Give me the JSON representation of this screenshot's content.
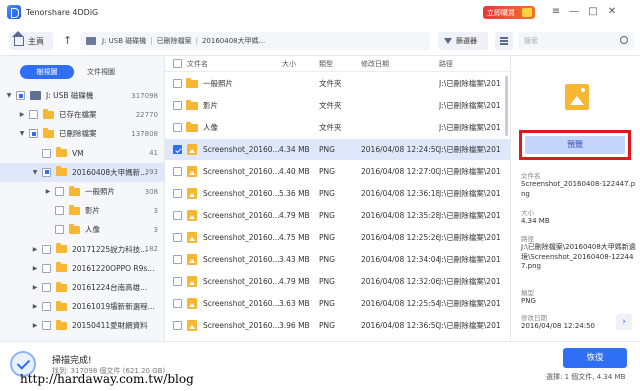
{
  "app": {
    "title": "Tenorshare 4DDiG",
    "buy_label": "立即購買"
  },
  "window_controls": [
    "—",
    "□",
    "✕"
  ],
  "toolbar": {
    "home_label": "主頁",
    "path": [
      "J: USB 磁碟機",
      "已刪除檔案",
      "20160408大甲媽..."
    ],
    "filter_label": "篩選器",
    "search_placeholder": "搜索"
  },
  "left": {
    "tabs": [
      "樹視圖",
      "文件視圖"
    ],
    "tree": [
      {
        "label": "J: USB 磁碟機",
        "count": "317098",
        "level": 0,
        "expand": "▼",
        "check": "part",
        "icon": "drive",
        "selected": false
      },
      {
        "label": "已存在檔案",
        "count": "22770",
        "level": 1,
        "expand": "▶",
        "check": "none",
        "icon": "folder",
        "selected": false
      },
      {
        "label": "已刪除檔案",
        "count": "137808",
        "level": 1,
        "expand": "▼",
        "check": "part",
        "icon": "folder",
        "selected": false
      },
      {
        "label": "VM",
        "count": "41",
        "level": 2,
        "expand": "",
        "check": "none",
        "icon": "folder",
        "selected": false
      },
      {
        "label": "20160408大甲媽新...",
        "count": "393",
        "level": 2,
        "expand": "▼",
        "check": "part",
        "icon": "folder",
        "selected": true
      },
      {
        "label": "一般照片",
        "count": "308",
        "level": 3,
        "expand": "▶",
        "check": "none",
        "icon": "folder",
        "selected": false
      },
      {
        "label": "影片",
        "count": "3",
        "level": 3,
        "expand": "",
        "check": "none",
        "icon": "folder",
        "selected": false
      },
      {
        "label": "人像",
        "count": "3",
        "level": 3,
        "expand": "",
        "check": "none",
        "icon": "folder",
        "selected": false
      },
      {
        "label": "20171225說力科技...",
        "count": "182",
        "level": 2,
        "expand": "▶",
        "check": "none",
        "icon": "folder",
        "selected": false
      },
      {
        "label": "20161220OPPO R9s...",
        "count": "",
        "level": 2,
        "expand": "▶",
        "check": "none",
        "icon": "folder",
        "selected": false
      },
      {
        "label": "20161224台南高雄...",
        "count": "",
        "level": 2,
        "expand": "▶",
        "check": "none",
        "icon": "folder",
        "selected": false
      },
      {
        "label": "20161019壩新新選程...",
        "count": "",
        "level": 2,
        "expand": "▶",
        "check": "none",
        "icon": "folder",
        "selected": false
      },
      {
        "label": "20150411愛財網資料",
        "count": "",
        "level": 2,
        "expand": "▶",
        "check": "none",
        "icon": "folder",
        "selected": false
      }
    ]
  },
  "list": {
    "headers": {
      "name": "文件名",
      "size": "大小",
      "type": "類型",
      "modified": "修改日期",
      "path": "路徑"
    },
    "rows": [
      {
        "name": "一般照片",
        "size": "",
        "type": "文件夾",
        "modified": "",
        "path": "J:\\已刪除檔案\\201",
        "icon": "folder",
        "checked": false,
        "selected": false
      },
      {
        "name": "影片",
        "size": "",
        "type": "文件夾",
        "modified": "",
        "path": "J:\\已刪除檔案\\201",
        "icon": "folder",
        "checked": false,
        "selected": false
      },
      {
        "name": "人像",
        "size": "",
        "type": "文件夾",
        "modified": "",
        "path": "J:\\已刪除檔案\\201",
        "icon": "folder",
        "checked": false,
        "selected": false
      },
      {
        "name": "Screenshot_20160...",
        "size": "4.34 MB",
        "type": "PNG",
        "modified": "2016/04/08 12:24:50",
        "path": "J:\\已刪除檔案\\201",
        "icon": "image",
        "checked": true,
        "selected": true
      },
      {
        "name": "Screenshot_20160...",
        "size": "4.40 MB",
        "type": "PNG",
        "modified": "2016/04/08 12:27:00",
        "path": "J:\\已刪除檔案\\201",
        "icon": "image",
        "checked": false,
        "selected": false
      },
      {
        "name": "Screenshot_20160...",
        "size": "5.36 MB",
        "type": "PNG",
        "modified": "2016/04/08 12:36:18",
        "path": "J:\\已刪除檔案\\201",
        "icon": "image",
        "checked": false,
        "selected": false
      },
      {
        "name": "Screenshot_20160...",
        "size": "4.79 MB",
        "type": "PNG",
        "modified": "2016/04/08 12:35:28",
        "path": "J:\\已刪除檔案\\201",
        "icon": "image",
        "checked": false,
        "selected": false
      },
      {
        "name": "Screenshot_20160...",
        "size": "4.75 MB",
        "type": "PNG",
        "modified": "2016/04/08 12:25:26",
        "path": "J:\\已刪除檔案\\201",
        "icon": "image",
        "checked": false,
        "selected": false
      },
      {
        "name": "Screenshot_20160...",
        "size": "3.43 MB",
        "type": "PNG",
        "modified": "2016/04/08 12:34:04",
        "path": "J:\\已刪除檔案\\201",
        "icon": "image",
        "checked": false,
        "selected": false
      },
      {
        "name": "Screenshot_20160...",
        "size": "4.79 MB",
        "type": "PNG",
        "modified": "2016/04/08 12:32:06",
        "path": "J:\\已刪除檔案\\201",
        "icon": "image",
        "checked": false,
        "selected": false
      },
      {
        "name": "Screenshot_20160...",
        "size": "3.63 MB",
        "type": "PNG",
        "modified": "2016/04/08 12:25:54",
        "path": "J:\\已刪除檔案\\201",
        "icon": "image",
        "checked": false,
        "selected": false
      },
      {
        "name": "Screenshot_20160...",
        "size": "3.96 MB",
        "type": "PNG",
        "modified": "2016/04/08 12:36:50",
        "path": "J:\\已刪除檔案\\201",
        "icon": "image",
        "checked": false,
        "selected": false
      }
    ]
  },
  "preview": {
    "button_label": "預覽",
    "filename_label": "文件名",
    "filename": "Screenshot_20160408-122447.png",
    "size_label": "大小",
    "size": "4.34 MB",
    "path_label": "路徑",
    "path": "J:\\已刪除檔案\\20160408大甲媽新遶境\\Screenshot_20160408-122447.png",
    "type_label": "類型",
    "type": "PNG",
    "modified_label": "修改日期",
    "modified": "2016/04/08 12:24:50"
  },
  "footer": {
    "scan_title": "掃描完成!",
    "scan_sub": "找到: 317098 個文件 (621.20 GB)",
    "recover_label": "恢復",
    "selection_info": "選擇: 1 個文件, 4.34 MB",
    "watermark": "http://hardaway.com.tw/blog"
  },
  "colors": {
    "accent": "#2f6ff5",
    "highlight_frame": "#e8141c",
    "folder": "#f7b733",
    "buy_gradient_start": "#e8383d"
  }
}
